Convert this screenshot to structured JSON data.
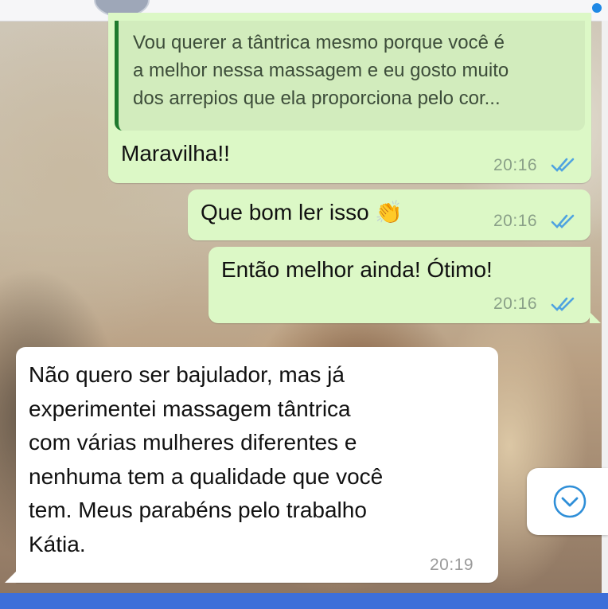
{
  "quoted_message": {
    "lines": [
      "Vou querer a tântrica mesmo porque você é",
      "a melhor nessa massagem e eu gosto muito",
      "dos arrepios que ela proporciona pelo cor..."
    ]
  },
  "messages": [
    {
      "text": "Maravilha!!",
      "time": "20:16",
      "direction": "outgoing",
      "status": "read"
    },
    {
      "text": "Que bom ler isso",
      "emoji": "👏",
      "time": "20:16",
      "direction": "outgoing",
      "status": "read"
    },
    {
      "text": "Então melhor ainda! Ótimo!",
      "time": "20:16",
      "direction": "outgoing",
      "status": "read"
    },
    {
      "lines": [
        "Não quero ser bajulador, mas já",
        "experimentei massagem tântrica",
        "com várias mulheres diferentes e",
        "nenhuma tem a qualidade que você",
        "tem. Meus parabéns pelo trabalho",
        "Kátia."
      ],
      "time": "20:19",
      "direction": "incoming"
    }
  ],
  "icons": {
    "read_ticks": "double-check-icon",
    "scroll_down": "chevron-down-circle-icon"
  },
  "colors": {
    "outgoing_bubble": "#dcf8c6",
    "incoming_bubble": "#ffffff",
    "read_tick": "#4fa3e0",
    "quote_bar": "#1f7a2e"
  }
}
